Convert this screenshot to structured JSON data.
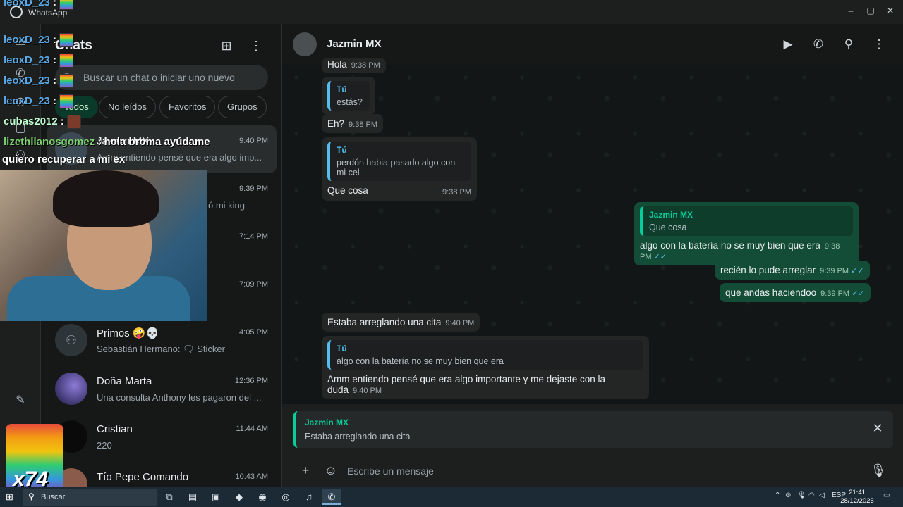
{
  "window": {
    "title": "WhatsApp",
    "controls": [
      "‒",
      "▢",
      "✕"
    ]
  },
  "sidebar": {
    "title": "Chats",
    "search_placeholder": "Buscar un chat o iniciar uno nuevo",
    "filters": [
      {
        "label": "Todos",
        "active": true
      },
      {
        "label": "No leídos",
        "active": false
      },
      {
        "label": "Favoritos",
        "active": false
      },
      {
        "label": "Grupos",
        "active": false
      }
    ],
    "chats": [
      {
        "name": "Jazmin MX",
        "time": "9:40 PM",
        "preview": "Amm entiendo pensé que era algo imp...",
        "selected": true
      },
      {
        "name": "",
        "time": "9:39 PM",
        "preview": "ó mi king",
        "selected": false
      },
      {
        "name": "",
        "time": "7:14 PM",
        "preview": "",
        "selected": false
      },
      {
        "name": "",
        "time": "7:09 PM",
        "preview": "",
        "selected": false
      },
      {
        "name": "Primos 🤪💀",
        "time": "4:05 PM",
        "preview": "Sebastián Hermano: 🗨 Sticker",
        "selected": false
      },
      {
        "name": "Doña Marta",
        "time": "12:36 PM",
        "preview": "Una consulta Anthony les pagaron del ...",
        "selected": false
      },
      {
        "name": "Cristian",
        "time": "11:44 AM",
        "preview": "220",
        "selected": false
      },
      {
        "name": "Tío Pepe Comando",
        "time": "10:43 AM",
        "preview": "",
        "selected": false
      }
    ]
  },
  "conversation": {
    "contact_name": "Jazmin MX",
    "messages": [
      {
        "dir": "in",
        "text": "Hola",
        "time": "9:38 PM"
      },
      {
        "dir": "in",
        "quote_author": "Tú",
        "quote_text": "estás?",
        "text": "",
        "time": ""
      },
      {
        "dir": "in",
        "text": "Eh?",
        "time": "9:38 PM"
      },
      {
        "dir": "in",
        "quote_author": "Tú",
        "quote_text": "perdón habia pasado algo con mi cel",
        "text": "Que cosa",
        "time": "9:38 PM"
      },
      {
        "dir": "out",
        "quote_author": "Jazmin MX",
        "quote_text": "Que cosa",
        "text": "algo con la batería no se muy bien que era",
        "time": "9:38 PM"
      },
      {
        "dir": "out",
        "text": "recién lo pude arreglar",
        "time": "9:39 PM"
      },
      {
        "dir": "out",
        "text": "que andas haciendoo",
        "time": "9:39 PM"
      },
      {
        "dir": "in",
        "text": "Estaba arreglando una cita",
        "time": "9:40 PM"
      },
      {
        "dir": "in",
        "quote_author": "Tú",
        "quote_text": "algo con la batería no se muy bien que era",
        "text": "Amm entiendo pensé que era algo importante y me dejaste con la duda",
        "time": "9:40 PM"
      }
    ]
  },
  "reply": {
    "author": "Jazmin MX",
    "text": "Estaba arreglando una cita"
  },
  "composer": {
    "placeholder": "Escribe un mensaje"
  },
  "stream_overlay": {
    "chat_lines": [
      {
        "user": "leoxD_23",
        "sep": ":"
      },
      {
        "user": "leoxD_23",
        "sep": ":"
      },
      {
        "user": "leoxD_23",
        "sep": ":"
      },
      {
        "user": "leoxD_23",
        "sep": ":"
      },
      {
        "user": "leoxD_23",
        "sep": ":"
      },
      {
        "user": "cubas2012",
        "sep": ":"
      },
      {
        "user": "lizethllanosgomez",
        "sep": ":",
        "text": "hola broma ayúdame"
      }
    ],
    "message": "quiero recuperar a mi ex",
    "counter": "x74"
  },
  "taskbar": {
    "search_placeholder": "Buscar",
    "language": "ESP",
    "time": "21:41",
    "date": "28/12/2025"
  },
  "colors": {
    "accent": "#06cf9c",
    "outgoing_bubble": "#144d37",
    "incoming_bubble": "#242626",
    "active_filter": "#0a3a2a"
  }
}
